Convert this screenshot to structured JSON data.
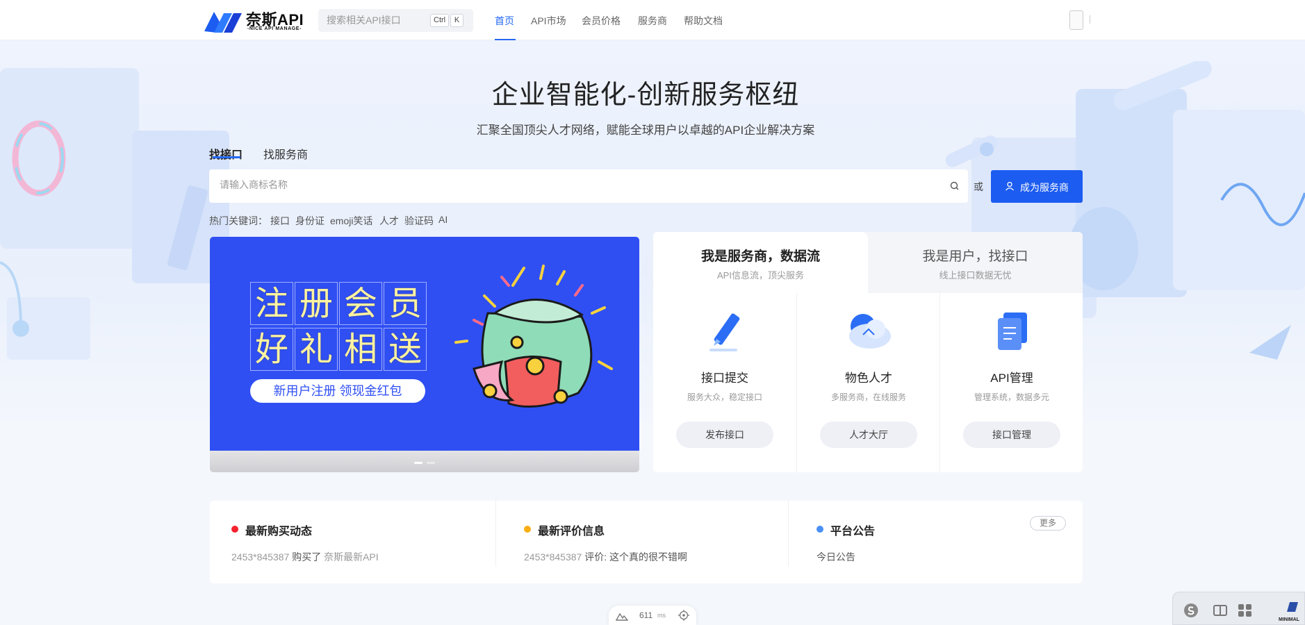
{
  "header": {
    "logo": {
      "name": "奈斯API",
      "sub": "-NICE API MANAGE-"
    },
    "search": {
      "placeholder": "搜索相关API接口",
      "kbd_ctrl": "Ctrl",
      "kbd_k": "K"
    },
    "nav": [
      "首页",
      "API市场",
      "会员价格",
      "服务商",
      "帮助文档"
    ],
    "active_nav": 0
  },
  "hero": {
    "title": "企业智能化-创新服务枢纽",
    "subtitle": "汇聚全国顶尖人才网络，赋能全球用户以卓越的API企业解决方案",
    "tabs": [
      "找接口",
      "找服务商"
    ],
    "search_placeholder": "请输入商标名称",
    "or_label": "或",
    "become_button": "成为服务商",
    "hot_label": "热门关键词：",
    "hot_keywords": [
      "接口",
      "身份证",
      "emoji笑话",
      "人才",
      "验证码",
      "AI"
    ]
  },
  "banner": {
    "chars": [
      "注",
      "册",
      "会",
      "员",
      "好",
      "礼",
      "相",
      "送"
    ],
    "pill": "新用户注册 领现金红包",
    "slide_count": 2,
    "active_slide": 0
  },
  "panel": {
    "tabs": [
      {
        "title": "我是服务商，数据流",
        "sub": "API信息流，顶尖服务"
      },
      {
        "title": "我是用户，找接口",
        "sub": "线上接口数据无忧"
      }
    ],
    "services": [
      {
        "title": "接口提交",
        "desc": "服务大众，稳定接口",
        "button": "发布接口",
        "icon": "pen-icon"
      },
      {
        "title": "物色人才",
        "desc": "多服务商，在线服务",
        "button": "人才大厅",
        "icon": "cloud-icon"
      },
      {
        "title": "API管理",
        "desc": "管理系统，数据多元",
        "button": "接口管理",
        "icon": "document-icon"
      }
    ]
  },
  "news": {
    "columns": [
      {
        "title": "最新购买动态",
        "dot_color": "#f5222d",
        "user": "2453*845387",
        "action": "购买了",
        "target": "奈斯最新API"
      },
      {
        "title": "最新评价信息",
        "dot_color": "#faad14",
        "user": "2453*845387",
        "action": "评价:",
        "target": "这个真的很不错啊"
      },
      {
        "title": "平台公告",
        "dot_color": "#4a90f2",
        "user": "",
        "action": "",
        "target": "今日公告"
      }
    ],
    "more": "更多"
  },
  "widgets": {
    "perf_value": "611",
    "perf_unit": "ms",
    "corner_label": "MINIMAL"
  },
  "colors": {
    "primary": "#2468f2",
    "button": "#1c5cf0",
    "banner": "#2f4ff3"
  }
}
